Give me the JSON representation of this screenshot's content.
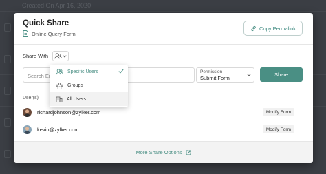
{
  "background": {
    "header_text": "Created On Apr 16, 2020"
  },
  "modal": {
    "title": "Quick Share",
    "form_name": "Online Query Form",
    "copy_permalink_label": "Copy Permalink",
    "share_with_label": "Share With",
    "search_placeholder": "Search En",
    "permission": {
      "label": "Permission",
      "value": "Submit Form"
    },
    "share_button_label": "Share",
    "users_label": "User(s)",
    "users": [
      {
        "email": "richardjohnson@zylker.com",
        "action_label": "Modify Form"
      },
      {
        "email": "kevin@zylker.com",
        "action_label": "Modify Form"
      }
    ],
    "more_share_options_label": "More Share Options"
  },
  "share_with_dropdown": {
    "items": [
      {
        "label": "Specific Users",
        "icon": "users-icon",
        "selected": true
      },
      {
        "label": "Groups",
        "icon": "groups-icon",
        "selected": false
      },
      {
        "label": "All Users",
        "icon": "building-icon",
        "selected": false
      }
    ]
  },
  "colors": {
    "accent": "#4a8f84",
    "overlay": "#3b3e44",
    "footer_bg": "#f3f3f3"
  }
}
